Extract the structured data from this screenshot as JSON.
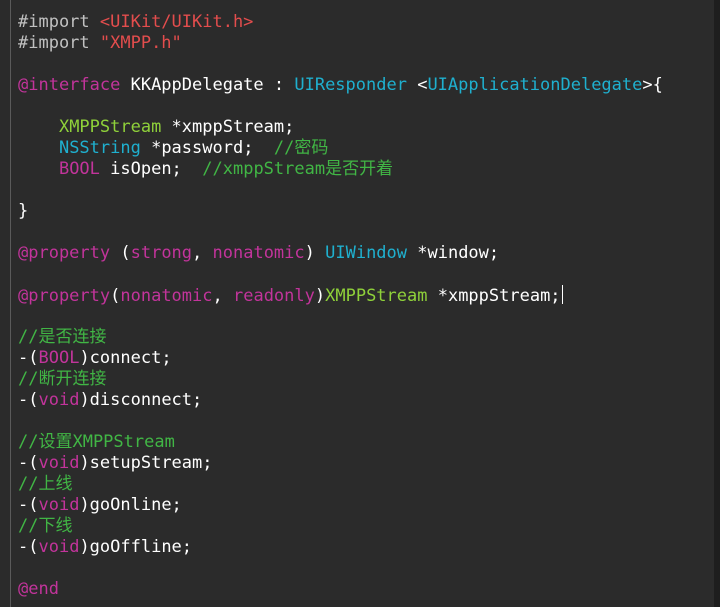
{
  "editor": {
    "lines": [
      [
        {
          "t": "#import ",
          "c": "directive"
        },
        {
          "t": "<UIKit/UIKit.h>",
          "c": "string"
        }
      ],
      [
        {
          "t": "#import ",
          "c": "directive"
        },
        {
          "t": "\"XMPP.h\"",
          "c": "string"
        }
      ],
      [],
      [
        {
          "t": "@interface",
          "c": "keyword"
        },
        {
          "t": " KKAppDelegate : ",
          "c": "default"
        },
        {
          "t": "UIResponder",
          "c": "type"
        },
        {
          "t": " <",
          "c": "default"
        },
        {
          "t": "UIApplicationDelegate",
          "c": "type"
        },
        {
          "t": ">{",
          "c": "default"
        }
      ],
      [],
      [
        {
          "t": "    ",
          "c": "default"
        },
        {
          "t": "XMPPStream",
          "c": "class"
        },
        {
          "t": " *xmppStream;",
          "c": "default"
        }
      ],
      [
        {
          "t": "    ",
          "c": "default"
        },
        {
          "t": "NSString",
          "c": "type"
        },
        {
          "t": " *password;  ",
          "c": "default"
        },
        {
          "t": "//密码",
          "c": "comment"
        }
      ],
      [
        {
          "t": "    ",
          "c": "default"
        },
        {
          "t": "BOOL",
          "c": "keyword"
        },
        {
          "t": " isOpen;  ",
          "c": "default"
        },
        {
          "t": "//xmppStream是否开着",
          "c": "comment"
        }
      ],
      [],
      [
        {
          "t": "}",
          "c": "default"
        }
      ],
      [],
      [
        {
          "t": "@property",
          "c": "keyword"
        },
        {
          "t": " (",
          "c": "default"
        },
        {
          "t": "strong",
          "c": "keyword"
        },
        {
          "t": ", ",
          "c": "default"
        },
        {
          "t": "nonatomic",
          "c": "keyword"
        },
        {
          "t": ") ",
          "c": "default"
        },
        {
          "t": "UIWindow",
          "c": "type"
        },
        {
          "t": " *window;",
          "c": "default"
        }
      ],
      [],
      [
        {
          "t": "@property",
          "c": "keyword"
        },
        {
          "t": "(",
          "c": "default"
        },
        {
          "t": "nonatomic",
          "c": "keyword"
        },
        {
          "t": ", ",
          "c": "default"
        },
        {
          "t": "readonly",
          "c": "keyword"
        },
        {
          "t": ")",
          "c": "default"
        },
        {
          "t": "XMPPStream",
          "c": "class"
        },
        {
          "t": " *xmppStream;",
          "c": "default"
        }
      ],
      [],
      [
        {
          "t": "//是否连接",
          "c": "comment"
        }
      ],
      [
        {
          "t": "-(",
          "c": "default"
        },
        {
          "t": "BOOL",
          "c": "keyword"
        },
        {
          "t": ")connect;",
          "c": "default"
        }
      ],
      [
        {
          "t": "//断开连接",
          "c": "comment"
        }
      ],
      [
        {
          "t": "-(",
          "c": "default"
        },
        {
          "t": "void",
          "c": "keyword"
        },
        {
          "t": ")disconnect;",
          "c": "default"
        }
      ],
      [],
      [
        {
          "t": "//设置XMPPStream",
          "c": "comment"
        }
      ],
      [
        {
          "t": "-(",
          "c": "default"
        },
        {
          "t": "void",
          "c": "keyword"
        },
        {
          "t": ")setupStream;",
          "c": "default"
        }
      ],
      [
        {
          "t": "//上线",
          "c": "comment"
        }
      ],
      [
        {
          "t": "-(",
          "c": "default"
        },
        {
          "t": "void",
          "c": "keyword"
        },
        {
          "t": ")goOnline;",
          "c": "default"
        }
      ],
      [
        {
          "t": "//下线",
          "c": "comment"
        }
      ],
      [
        {
          "t": "-(",
          "c": "default"
        },
        {
          "t": "void",
          "c": "keyword"
        },
        {
          "t": ")goOffline;",
          "c": "default"
        }
      ],
      [],
      [
        {
          "t": "@end",
          "c": "keyword"
        }
      ]
    ],
    "cursor_line": 14,
    "colors": {
      "background": "#2b2b2b",
      "directive": "#c1c1c1",
      "string": "#e34d4d",
      "keyword": "#c2349b",
      "type": "#1fb0cf",
      "class": "#8fd13a",
      "comment": "#41b645",
      "default": "#ffffff"
    }
  }
}
